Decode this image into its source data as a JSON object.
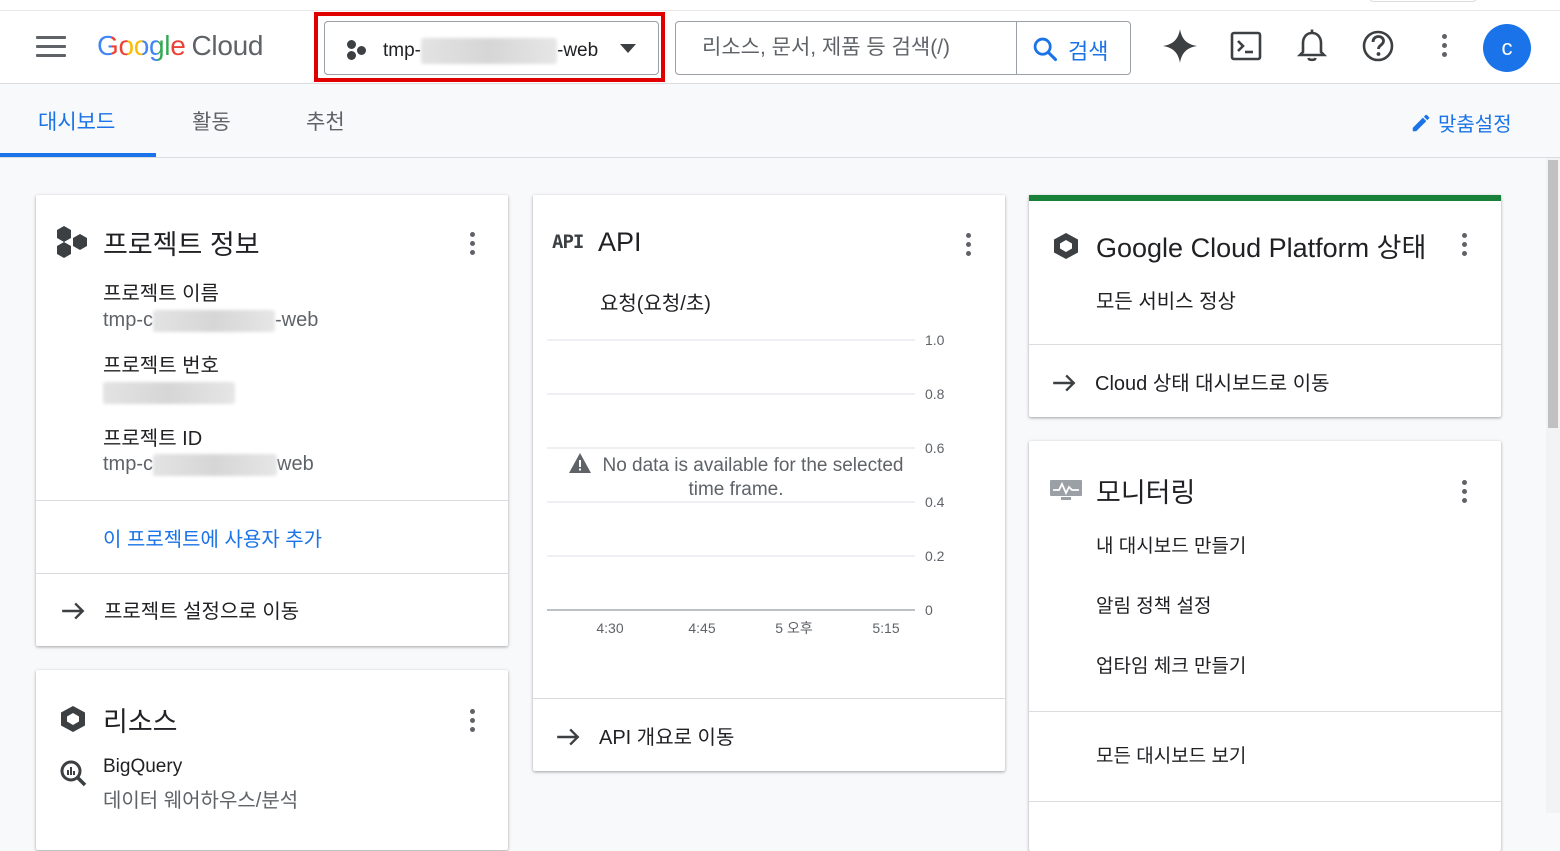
{
  "header": {
    "logo_google": "Google",
    "logo_cloud": "Cloud",
    "project_prefix": "tmp-",
    "project_suffix": "-web",
    "search_placeholder": "리소스, 문서, 제품 등 검색(/)",
    "search_button": "검색",
    "avatar_letter": "c",
    "icons": [
      "menu-icon",
      "gemini-spark-icon",
      "cloud-shell-icon",
      "notifications-bell-icon",
      "help-icon",
      "more-vert-icon"
    ],
    "highlight_color": "#e00000"
  },
  "tabs": {
    "items": [
      "대시보드",
      "활동",
      "추천"
    ],
    "active": "대시보드",
    "customize": "맞춤설정"
  },
  "project_info": {
    "title": "프로젝트 정보",
    "name_label": "프로젝트 이름",
    "name_prefix": "tmp-c",
    "name_suffix": "-web",
    "number_label": "프로젝트 번호",
    "id_label": "프로젝트 ID",
    "id_prefix": "tmp-c",
    "id_suffix": "web",
    "add_user": "이 프로젝트에 사용자 추가",
    "settings_link": "프로젝트 설정으로 이동"
  },
  "resources": {
    "title": "리소스",
    "bigquery_name": "BigQuery",
    "bigquery_desc": "데이터 웨어하우스/분석"
  },
  "api": {
    "icon_text": "API",
    "title": "API",
    "subtitle": "요청(요청/초)",
    "no_data": "No data is available for the selected time frame.",
    "overview_link": "API 개요로 이동"
  },
  "chart_data": {
    "type": "line",
    "title": "요청(요청/초)",
    "x": [
      "4:30",
      "4:45",
      "5 오후",
      "5:15"
    ],
    "y_ticks": [
      "1.0",
      "0.8",
      "0.6",
      "0.4",
      "0.2",
      "0"
    ],
    "ylim": [
      0,
      1.0
    ],
    "series": [],
    "grid": true,
    "y_axis_side": "right"
  },
  "gcp_status": {
    "title": "Google Cloud Platform 상태",
    "status": "모든 서비스 정상",
    "link": "Cloud 상태 대시보드로 이동",
    "accent_color": "#188038"
  },
  "monitoring": {
    "title": "모니터링",
    "items": [
      "내 대시보드 만들기",
      "알림 정책 설정",
      "업타임 체크 만들기"
    ],
    "view_all": "모든 대시보드 보기"
  },
  "colors": {
    "primary_blue": "#1a73e8",
    "text": "#202124",
    "muted": "#5f6368"
  }
}
